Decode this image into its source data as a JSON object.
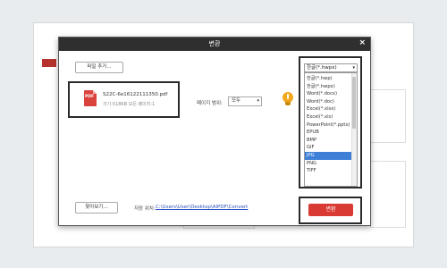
{
  "dialog": {
    "title": "변환",
    "close_glyph": "×",
    "add_file_label": "파일 추가...",
    "file": {
      "name": "S22C-6e16122111350.pdf",
      "meta": "크기:518KB   모든 페이지:1",
      "icon_text": "PDF"
    },
    "page_range": {
      "label": "페이지 범위:",
      "value": "모두"
    },
    "format": {
      "selected": "한글(*.hwpx)",
      "options": [
        "한글(*.hwp)",
        "한글(*.hwpx)",
        "Word(*.docx)",
        "Word(*.doc)",
        "Excel(*.xlsx)",
        "Excel(*.xls)",
        "PowerPoint(*.pptx)",
        "EPUB",
        "BMP",
        "GIF",
        "JPG",
        "PNG",
        "TIFF"
      ],
      "highlighted": "JPG"
    },
    "browse_label": "찾아보기...",
    "save_location": {
      "label": "저장 위치:",
      "path": "C:\\Users\\User\\Desktop\\AlPDF\\Convert"
    },
    "convert_label": "변환"
  },
  "colors": {
    "titlebar": "#2f2f2f",
    "convert_button": "#d93a33",
    "selection": "#3d7fd6",
    "path_link": "#2a52be",
    "pdf_icon": "#d9433b",
    "tip_icon": "#f2a81d"
  },
  "icons": {
    "file_icon": "pdf-file-icon",
    "tip_icon": "lightbulb-icon"
  }
}
